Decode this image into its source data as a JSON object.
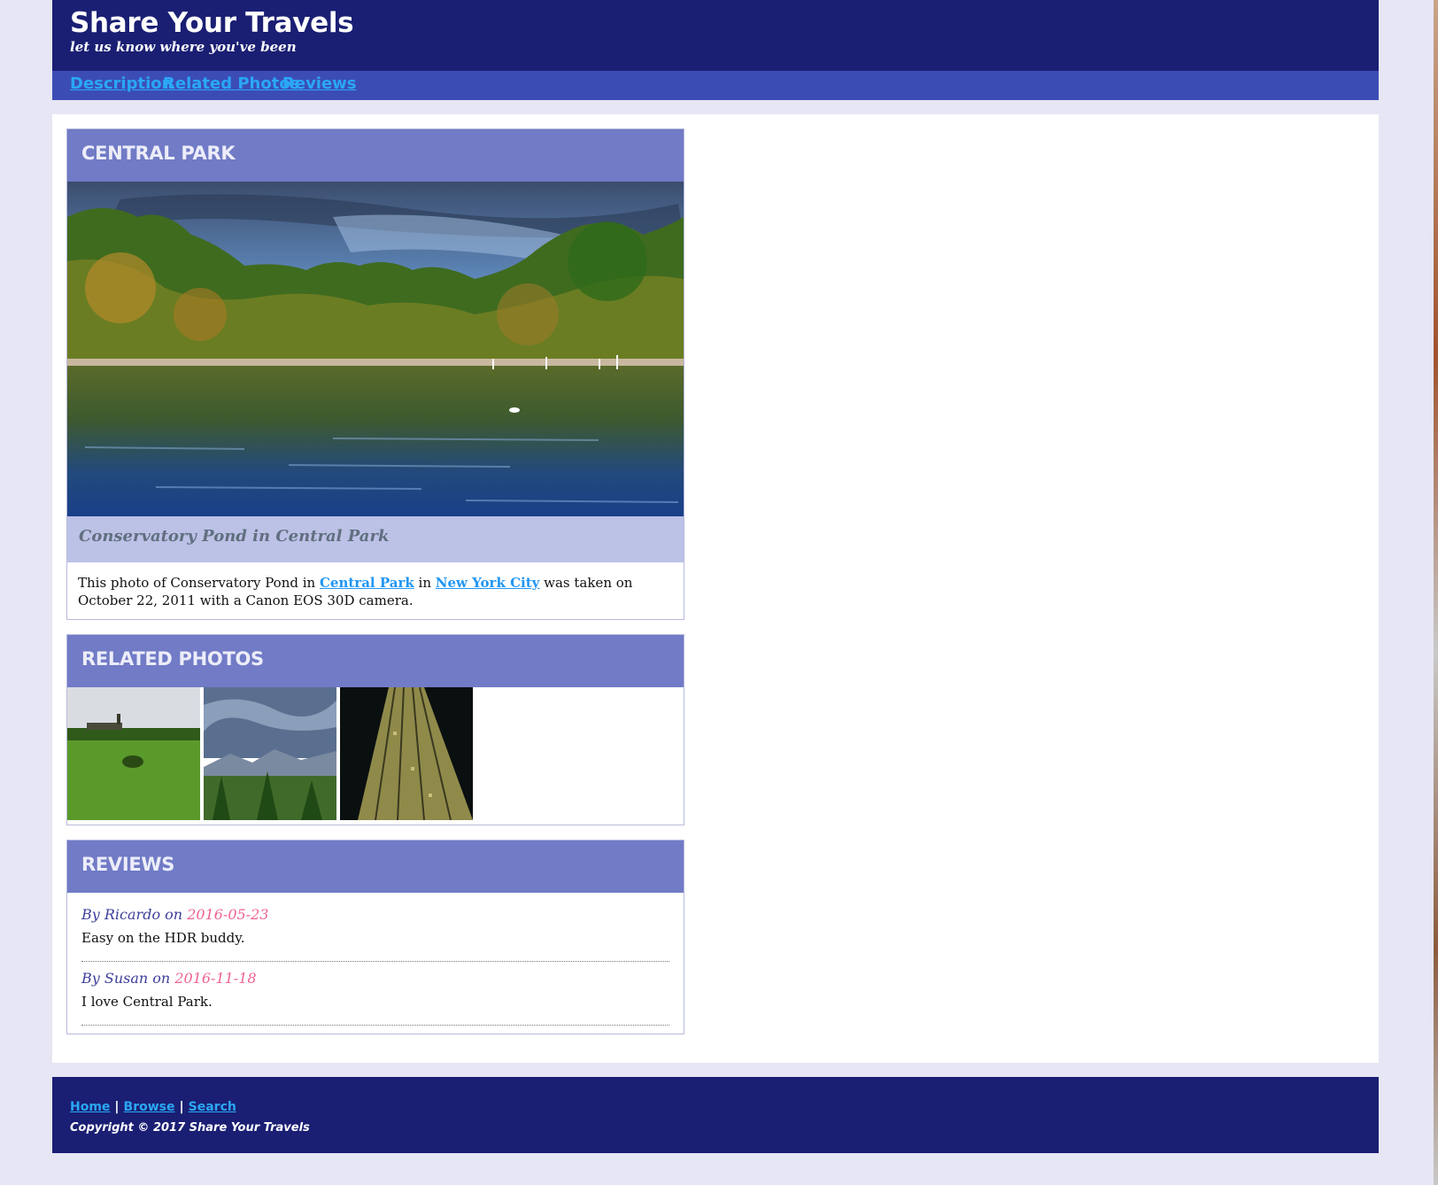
{
  "header": {
    "title": "Share Your Travels",
    "tagline": "let us know where you've been"
  },
  "nav": {
    "items": [
      "Description",
      "Related Photos",
      "Reviews"
    ]
  },
  "photo": {
    "heading": "CENTRAL PARK",
    "image_icon": "landscape-photo",
    "caption": "Conservatory Pond in Central Park",
    "description": {
      "part1": "This photo of Conservatory Pond in ",
      "link1": "Central Park",
      "part2": " in ",
      "link2": "New York City",
      "part3": " was taken on October 22, 2011 with a Canon EOS 30D camera."
    }
  },
  "related": {
    "heading": "RELATED PHOTOS",
    "thumbnails": [
      "field-with-church-photo",
      "mountain-valley-photo",
      "skyscraper-photo"
    ]
  },
  "reviews": {
    "heading": "REVIEWS",
    "items": [
      {
        "by": "By Ricardo on ",
        "date": "2016-05-23",
        "text": "Easy on the HDR buddy."
      },
      {
        "by": "By Susan on ",
        "date": "2016-11-18",
        "text": "I love Central Park."
      }
    ]
  },
  "footer": {
    "links": [
      "Home",
      "Browse",
      "Search"
    ],
    "separator": "|",
    "copyright": "Copyright © 2017 Share Your Travels"
  },
  "colors": {
    "header_bg": "#1a1f73",
    "nav_bg": "#3b4db5",
    "panel_heading_bg": "#717bc6",
    "link": "#2aa7f5",
    "review_date": "#f06292"
  }
}
